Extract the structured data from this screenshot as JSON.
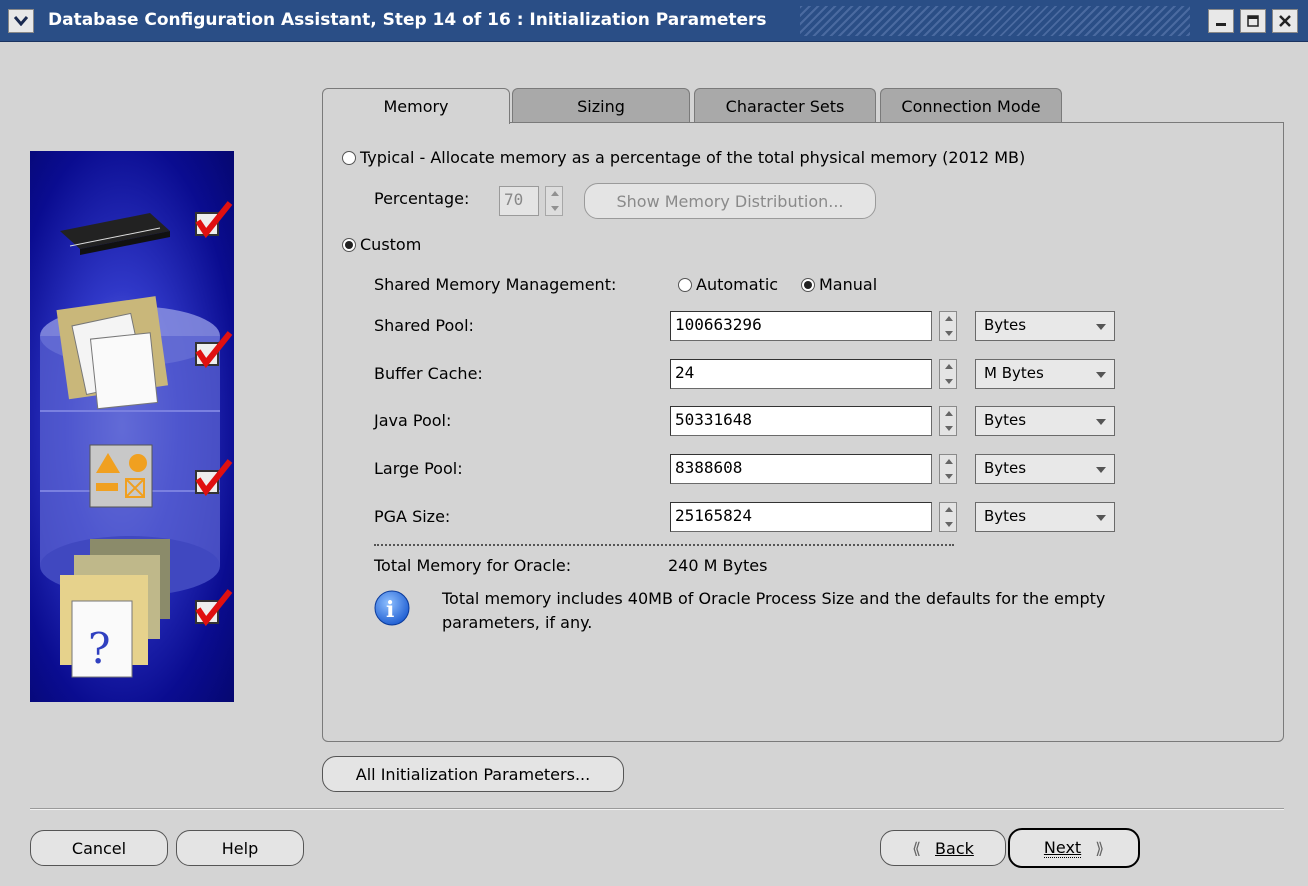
{
  "window": {
    "title": "Database Configuration Assistant, Step 14 of 16 : Initialization Parameters"
  },
  "tabs": [
    {
      "label": "Memory",
      "active": true
    },
    {
      "label": "Sizing",
      "active": false
    },
    {
      "label": "Character Sets",
      "active": false
    },
    {
      "label": "Connection Mode",
      "active": false
    }
  ],
  "memory": {
    "typical_label": "Typical - Allocate memory as a percentage of the total physical memory (2012 MB)",
    "percentage_label": "Percentage:",
    "percentage_value": "70",
    "show_distribution_label": "Show Memory Distribution...",
    "custom_label": "Custom",
    "shared_mgmt_label": "Shared Memory Management:",
    "automatic_label": "Automatic",
    "manual_label": "Manual",
    "selected_mode": "Custom",
    "selected_mgmt": "Manual",
    "params": [
      {
        "label": "Shared Pool:",
        "value": "100663296",
        "unit": "Bytes"
      },
      {
        "label": "Buffer Cache:",
        "value": "24",
        "unit": "M Bytes"
      },
      {
        "label": "Java Pool:",
        "value": "50331648",
        "unit": "Bytes"
      },
      {
        "label": "Large Pool:",
        "value": "8388608",
        "unit": "Bytes"
      },
      {
        "label": "PGA Size:",
        "value": "25165824",
        "unit": "Bytes"
      }
    ],
    "total_label": "Total Memory for Oracle:",
    "total_value": "240 M Bytes",
    "info_text_line1": "Total memory includes 40MB of Oracle Process Size and the defaults for the empty",
    "info_text_line2": "parameters, if any."
  },
  "buttons": {
    "all_params": "All Initialization Parameters...",
    "cancel": "Cancel",
    "help": "Help",
    "back": "Back",
    "next": "Next"
  }
}
